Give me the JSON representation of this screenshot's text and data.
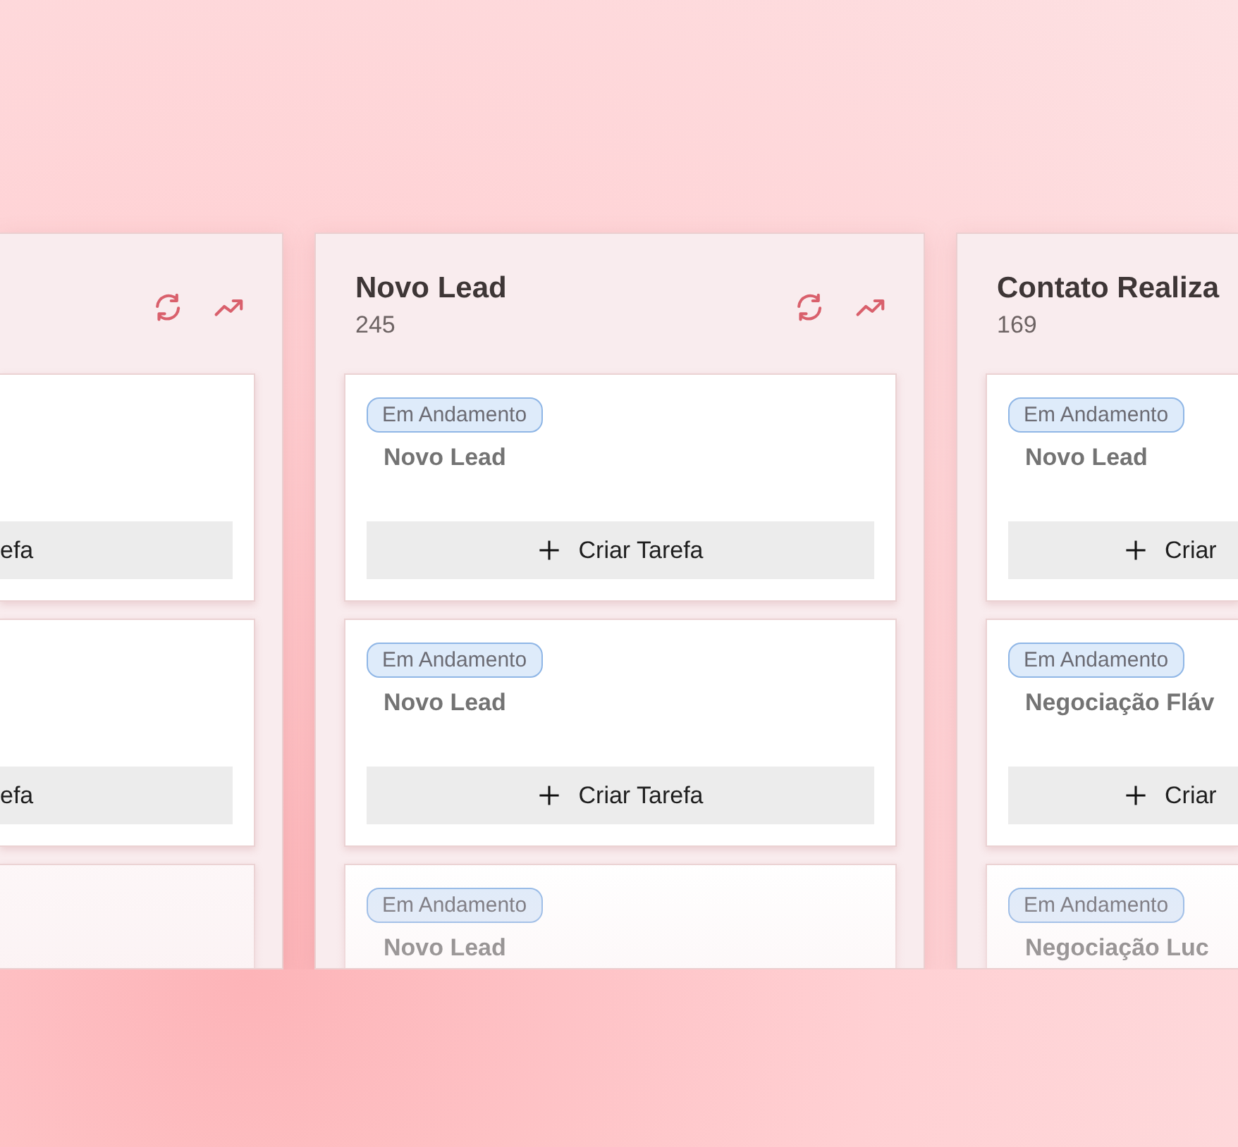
{
  "columns": [
    {
      "kind": "cut-left",
      "cards": [
        {
          "kind": "task",
          "button": {
            "label": "efa"
          }
        },
        {
          "kind": "task",
          "button": {
            "label": "efa"
          }
        },
        {
          "kind": "blank"
        }
      ]
    },
    {
      "kind": "full",
      "title": "Novo Lead",
      "count": "245",
      "cards": [
        {
          "kind": "task",
          "tag": "Em Andamento",
          "title": "Novo Lead",
          "button": {
            "label": "Criar Tarefa"
          }
        },
        {
          "kind": "task",
          "tag": "Em Andamento",
          "title": "Novo Lead",
          "button": {
            "label": "Criar Tarefa"
          }
        },
        {
          "kind": "task",
          "tag": "Em Andamento",
          "title": "Novo Lead"
        }
      ]
    },
    {
      "kind": "cut-right",
      "title": "Contato Realiza",
      "count": "169",
      "cards": [
        {
          "kind": "task",
          "tag": "Em Andamento",
          "title": "Novo Lead",
          "button": {
            "label": "Criar"
          }
        },
        {
          "kind": "task",
          "tag": "Em Andamento",
          "title": "Negociação Fláv",
          "button": {
            "label": "Criar"
          }
        },
        {
          "kind": "task",
          "tag": "Em Andamento",
          "title": "Negociação Luc"
        }
      ]
    }
  ]
}
